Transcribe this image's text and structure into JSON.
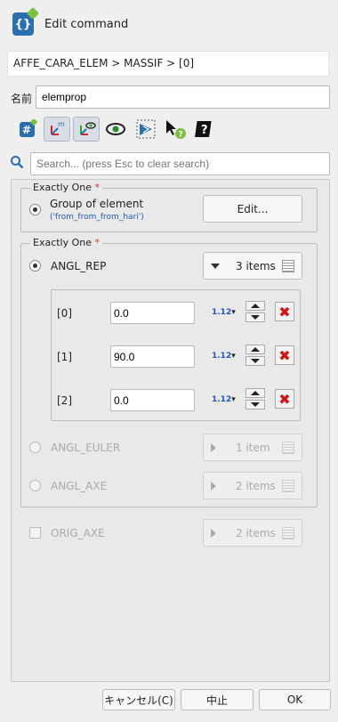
{
  "window": {
    "title": "Edit command"
  },
  "path": "AFFE_CARA_ELEM > MASSIF > [0]",
  "name": {
    "label": "名前",
    "value": "elemprop"
  },
  "search": {
    "placeholder": "Search... (press Esc to clear search)"
  },
  "group1": {
    "title": "Exactly One",
    "required_mark": "*",
    "option_label": "Group of element",
    "option_sub": "('from_from_from_hari')",
    "edit_button": "Edit..."
  },
  "group2": {
    "title": "Exactly One",
    "required_mark": "*",
    "angl_rep": {
      "label": "ANGL_REP",
      "items": "3 items"
    },
    "rows": [
      {
        "index": "[0]",
        "value": "0.0",
        "format": "1.12"
      },
      {
        "index": "[1]",
        "value": "90.0",
        "format": "1.12"
      },
      {
        "index": "[2]",
        "value": "0.0",
        "format": "1.12"
      }
    ],
    "angl_euler": {
      "label": "ANGL_EULER",
      "items": "1 item"
    },
    "angl_axe": {
      "label": "ANGL_AXE",
      "items": "2 items"
    }
  },
  "orig_axe": {
    "label": "ORIG_AXE",
    "items": "2 items"
  },
  "buttons": {
    "cancel": "キャンセル(C)",
    "abort": "中止",
    "ok": "OK"
  },
  "icons": {
    "app": "command-edit-icon",
    "toolbar": [
      "hash-edit-icon",
      "axes-m-icon",
      "axes-eye-icon",
      "eye-icon",
      "mesh-select-icon",
      "pointer-help-icon",
      "command-help-icon"
    ],
    "search": "search-icon"
  },
  "colors": {
    "accent": "#2c6fb0",
    "delete": "#d31111",
    "required": "#dd3333",
    "format_text": "#2255bb"
  }
}
